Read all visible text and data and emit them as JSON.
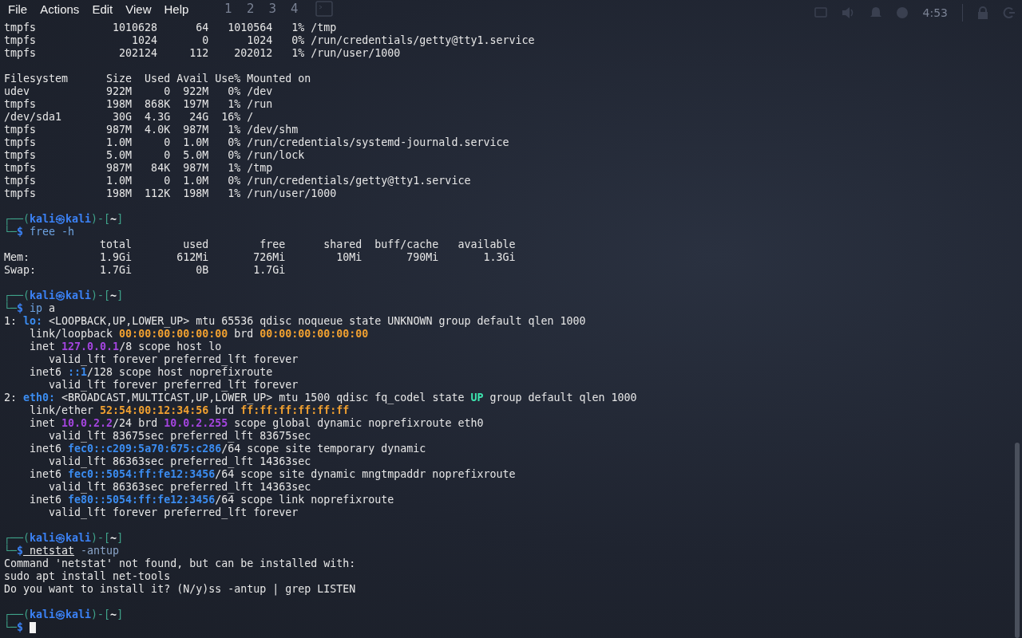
{
  "menu": {
    "items": [
      "File",
      "Actions",
      "Edit",
      "View",
      "Help"
    ]
  },
  "panel": {
    "workspaces": [
      "1",
      "2",
      "3",
      "4"
    ],
    "clock": "4:53"
  },
  "lines": [
    {
      "kind": "output",
      "segs": [
        {
          "t": "tmpfs            1010628      64   1010564   1% /tmp",
          "kind": "plain"
        }
      ]
    },
    {
      "kind": "output",
      "segs": [
        {
          "t": "tmpfs               1024       0      1024   0% /run/credentials/getty@tty1.service",
          "kind": "plain"
        }
      ]
    },
    {
      "kind": "output",
      "segs": [
        {
          "t": "tmpfs             202124     112    202012   1% /run/user/1000",
          "kind": "plain"
        }
      ]
    },
    {
      "kind": "blank"
    },
    {
      "kind": "output",
      "segs": [
        {
          "t": "Filesystem      Size  Used Avail Use% Mounted on",
          "kind": "plain"
        }
      ]
    },
    {
      "kind": "output",
      "segs": [
        {
          "t": "udev            922M     0  922M   0% /dev",
          "kind": "plain"
        }
      ]
    },
    {
      "kind": "output",
      "segs": [
        {
          "t": "tmpfs           198M  868K  197M   1% /run",
          "kind": "plain"
        }
      ]
    },
    {
      "kind": "output",
      "segs": [
        {
          "t": "/dev/sda1        30G  4.3G   24G  16% /",
          "kind": "plain"
        }
      ]
    },
    {
      "kind": "output",
      "segs": [
        {
          "t": "tmpfs           987M  4.0K  987M   1% /dev/shm",
          "kind": "plain"
        }
      ]
    },
    {
      "kind": "output",
      "segs": [
        {
          "t": "tmpfs           1.0M     0  1.0M   0% /run/credentials/systemd-journald.service",
          "kind": "plain"
        }
      ]
    },
    {
      "kind": "output",
      "segs": [
        {
          "t": "tmpfs           5.0M     0  5.0M   0% /run/lock",
          "kind": "plain"
        }
      ]
    },
    {
      "kind": "output",
      "segs": [
        {
          "t": "tmpfs           987M   84K  987M   1% /tmp",
          "kind": "plain"
        }
      ]
    },
    {
      "kind": "output",
      "segs": [
        {
          "t": "tmpfs           1.0M     0  1.0M   0% /run/credentials/getty@tty1.service",
          "kind": "plain"
        }
      ]
    },
    {
      "kind": "output",
      "segs": [
        {
          "t": "tmpfs           198M  112K  198M   1% /run/user/1000",
          "kind": "plain"
        }
      ]
    },
    {
      "kind": "blank"
    },
    {
      "kind": "prompt",
      "segs": [
        {
          "t": "┌──(",
          "kind": "frame"
        },
        {
          "t": "kali㉿kali",
          "kind": "user"
        },
        {
          "t": ")-[",
          "kind": "frame"
        },
        {
          "t": "~",
          "kind": "dir"
        },
        {
          "t": "]",
          "kind": "frame"
        }
      ]
    },
    {
      "kind": "command",
      "segs": [
        {
          "t": "└─",
          "kind": "frame"
        },
        {
          "t": "$",
          "kind": "user"
        },
        {
          "t": " free -h",
          "kind": "cmd"
        }
      ]
    },
    {
      "kind": "output",
      "segs": [
        {
          "t": "               total        used        free      shared  buff/cache   available",
          "kind": "plain"
        }
      ]
    },
    {
      "kind": "output",
      "segs": [
        {
          "t": "Mem:           1.9Gi       612Mi       726Mi        10Mi       790Mi       1.3Gi",
          "kind": "plain"
        }
      ]
    },
    {
      "kind": "output",
      "segs": [
        {
          "t": "Swap:          1.7Gi          0B       1.7Gi",
          "kind": "plain"
        }
      ]
    },
    {
      "kind": "blank"
    },
    {
      "kind": "prompt",
      "segs": [
        {
          "t": "┌──(",
          "kind": "frame"
        },
        {
          "t": "kali㉿kali",
          "kind": "user"
        },
        {
          "t": ")-[",
          "kind": "frame"
        },
        {
          "t": "~",
          "kind": "dir"
        },
        {
          "t": "]",
          "kind": "frame"
        }
      ]
    },
    {
      "kind": "command",
      "segs": [
        {
          "t": "└─",
          "kind": "frame"
        },
        {
          "t": "$",
          "kind": "user"
        },
        {
          "t": " ip",
          "kind": "cmd"
        },
        {
          "t": " a",
          "kind": "plain"
        }
      ]
    },
    {
      "kind": "output",
      "segs": [
        {
          "t": "1: ",
          "kind": "plain"
        },
        {
          "t": "lo:",
          "kind": "blue"
        },
        {
          "t": " <LOOPBACK,UP,LOWER_UP> mtu 65536 qdisc noqueue state UNKNOWN group default qlen 1000",
          "kind": "plain"
        }
      ]
    },
    {
      "kind": "output",
      "segs": [
        {
          "t": "    link/loopback ",
          "kind": "plain"
        },
        {
          "t": "00:00:00:00:00:00",
          "kind": "orange"
        },
        {
          "t": " brd ",
          "kind": "plain"
        },
        {
          "t": "00:00:00:00:00:00",
          "kind": "orange"
        }
      ]
    },
    {
      "kind": "output",
      "segs": [
        {
          "t": "    inet ",
          "kind": "plain"
        },
        {
          "t": "127.0.0.1",
          "kind": "purple"
        },
        {
          "t": "/8 scope host lo",
          "kind": "plain"
        }
      ]
    },
    {
      "kind": "output",
      "segs": [
        {
          "t": "       valid_lft forever preferred_lft forever",
          "kind": "plain"
        }
      ]
    },
    {
      "kind": "output",
      "segs": [
        {
          "t": "    inet6 ",
          "kind": "plain"
        },
        {
          "t": "::1",
          "kind": "blue"
        },
        {
          "t": "/128 scope host noprefixroute",
          "kind": "plain"
        }
      ]
    },
    {
      "kind": "output",
      "segs": [
        {
          "t": "       valid_lft forever preferred_lft forever",
          "kind": "plain"
        }
      ]
    },
    {
      "kind": "output",
      "segs": [
        {
          "t": "2: ",
          "kind": "plain"
        },
        {
          "t": "eth0:",
          "kind": "blue"
        },
        {
          "t": " <BROADCAST,MULTICAST,UP,LOWER_UP> mtu 1500 qdisc fq_codel state ",
          "kind": "plain"
        },
        {
          "t": "UP",
          "kind": "green"
        },
        {
          "t": " group default qlen 1000",
          "kind": "plain"
        }
      ]
    },
    {
      "kind": "output",
      "segs": [
        {
          "t": "    link/ether ",
          "kind": "plain"
        },
        {
          "t": "52:54:00:12:34:56",
          "kind": "orange"
        },
        {
          "t": " brd ",
          "kind": "plain"
        },
        {
          "t": "ff:ff:ff:ff:ff:ff",
          "kind": "orange"
        }
      ]
    },
    {
      "kind": "output",
      "segs": [
        {
          "t": "    inet ",
          "kind": "plain"
        },
        {
          "t": "10.0.2.2",
          "kind": "purple"
        },
        {
          "t": "/24 brd ",
          "kind": "plain"
        },
        {
          "t": "10.0.2.255",
          "kind": "purple"
        },
        {
          "t": " scope global dynamic noprefixroute eth0",
          "kind": "plain"
        }
      ]
    },
    {
      "kind": "output",
      "segs": [
        {
          "t": "       valid_lft 83675sec preferred_lft 83675sec",
          "kind": "plain"
        }
      ]
    },
    {
      "kind": "output",
      "segs": [
        {
          "t": "    inet6 ",
          "kind": "plain"
        },
        {
          "t": "fec0::c209:5a70:675:c286",
          "kind": "blue"
        },
        {
          "t": "/64 scope site temporary dynamic",
          "kind": "plain"
        }
      ]
    },
    {
      "kind": "output",
      "segs": [
        {
          "t": "       valid_lft 86363sec preferred_lft 14363sec",
          "kind": "plain"
        }
      ]
    },
    {
      "kind": "output",
      "segs": [
        {
          "t": "    inet6 ",
          "kind": "plain"
        },
        {
          "t": "fec0::5054:ff:fe12:3456",
          "kind": "blue"
        },
        {
          "t": "/64 scope site dynamic mngtmpaddr noprefixroute",
          "kind": "plain"
        }
      ]
    },
    {
      "kind": "output",
      "segs": [
        {
          "t": "       valid_lft 86363sec preferred_lft 14363sec",
          "kind": "plain"
        }
      ]
    },
    {
      "kind": "output",
      "segs": [
        {
          "t": "    inet6 ",
          "kind": "plain"
        },
        {
          "t": "fe80::5054:ff:fe12:3456",
          "kind": "blue"
        },
        {
          "t": "/64 scope link noprefixroute",
          "kind": "plain"
        }
      ]
    },
    {
      "kind": "output",
      "segs": [
        {
          "t": "       valid_lft forever preferred_lft forever",
          "kind": "plain"
        }
      ]
    },
    {
      "kind": "blank"
    },
    {
      "kind": "prompt",
      "segs": [
        {
          "t": "┌──(",
          "kind": "frame"
        },
        {
          "t": "kali㉿kali",
          "kind": "user"
        },
        {
          "t": ")-[",
          "kind": "frame"
        },
        {
          "t": "~",
          "kind": "dir"
        },
        {
          "t": "]",
          "kind": "frame"
        }
      ]
    },
    {
      "kind": "command",
      "segs": [
        {
          "t": "└─",
          "kind": "frame"
        },
        {
          "t": "$",
          "kind": "user"
        },
        {
          "t": " netstat",
          "kind": "unknown"
        },
        {
          "t": " -antup",
          "kind": "arg"
        }
      ]
    },
    {
      "kind": "output",
      "segs": [
        {
          "t": "Command 'netstat' not found, but can be installed with:",
          "kind": "plain"
        }
      ]
    },
    {
      "kind": "output",
      "segs": [
        {
          "t": "sudo apt install net-tools",
          "kind": "plain"
        }
      ]
    },
    {
      "kind": "output",
      "segs": [
        {
          "t": "Do you want to install it? (N/y)ss -antup | grep LISTEN",
          "kind": "plain"
        }
      ]
    },
    {
      "kind": "blank"
    },
    {
      "kind": "prompt",
      "segs": [
        {
          "t": "┌──(",
          "kind": "frame"
        },
        {
          "t": "kali㉿kali",
          "kind": "user"
        },
        {
          "t": ")-[",
          "kind": "frame"
        },
        {
          "t": "~",
          "kind": "dir"
        },
        {
          "t": "]",
          "kind": "frame"
        }
      ]
    },
    {
      "kind": "input",
      "segs": [
        {
          "t": "└─",
          "kind": "frame"
        },
        {
          "t": "$",
          "kind": "user"
        }
      ]
    }
  ]
}
